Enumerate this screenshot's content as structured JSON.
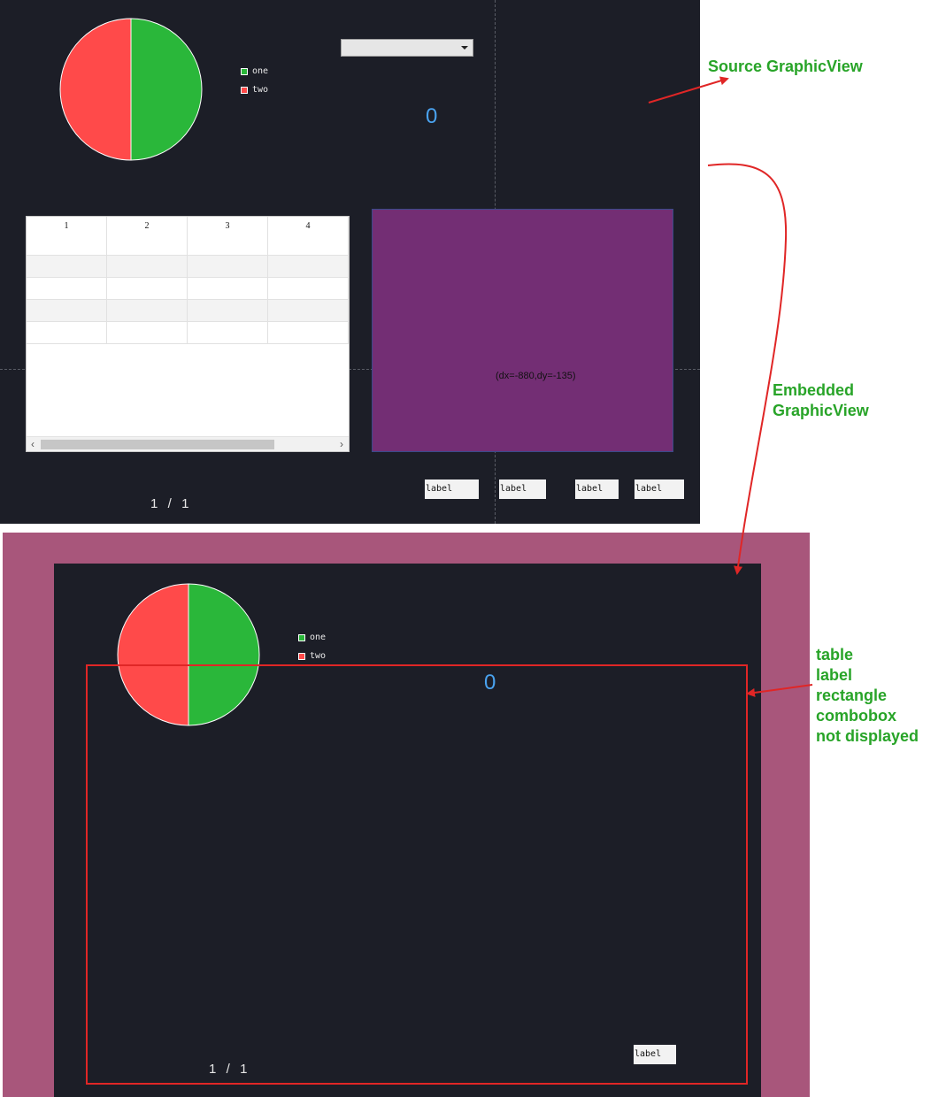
{
  "source_view": {
    "combobox": {
      "value": ""
    },
    "legend": [
      {
        "label": "one",
        "color": "#2ab73a"
      },
      {
        "label": "two",
        "color": "#ff4a4a"
      }
    ],
    "pie_chart": {
      "slices": [
        {
          "label": "one",
          "value": 50,
          "color": "#2ab73a"
        },
        {
          "label": "two",
          "value": 50,
          "color": "#ff4a4a"
        }
      ]
    },
    "counter": "0",
    "table": {
      "columns": [
        "1",
        "2",
        "3",
        "4"
      ],
      "row_count": 4,
      "scroll_left_icon": "chevron-left-icon",
      "scroll_right_icon": "chevron-right-icon"
    },
    "rectangle": {
      "coords_text": "(dx=-880,dy=-135)",
      "color": "#732e74"
    },
    "labels": [
      "label",
      "label",
      "label",
      "label"
    ],
    "pager": "1  /  1"
  },
  "embedded_view": {
    "legend": [
      {
        "label": "one",
        "color": "#2ab73a"
      },
      {
        "label": "two",
        "color": "#ff4a4a"
      }
    ],
    "counter": "0",
    "label": "label",
    "pager": "1  /  1",
    "frame_color": "#a8567b"
  },
  "annotations": {
    "source": "Source GraphicView",
    "embedded_line1": "Embedded",
    "embedded_line2": "GraphicView",
    "missing": [
      "table",
      "label",
      "rectangle",
      "combobox",
      "not displayed"
    ],
    "arrow_color": "#e02626",
    "text_color": "#28a428"
  }
}
